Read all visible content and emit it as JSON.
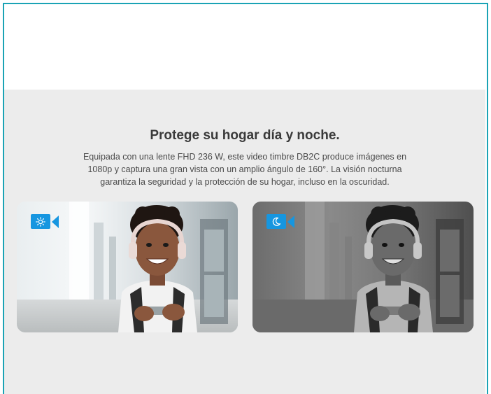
{
  "feature": {
    "title": "Protege su hogar día y noche.",
    "description": "Equipada con una lente FHD 236 W, este video timbre DB2C produce imágenes en 1080p y captura una gran vista con un amplio ángulo de 160°. La visión nocturna garantiza la seguridad y la protección de su hogar, incluso en la oscuridad."
  },
  "cards": [
    {
      "mode": "day",
      "icon": "sun-camera-icon"
    },
    {
      "mode": "night",
      "icon": "moon-camera-icon"
    }
  ],
  "colors": {
    "frame_border": "#1aa3b5",
    "section_bg": "#ececec",
    "icon_blue": "#1696e0"
  }
}
